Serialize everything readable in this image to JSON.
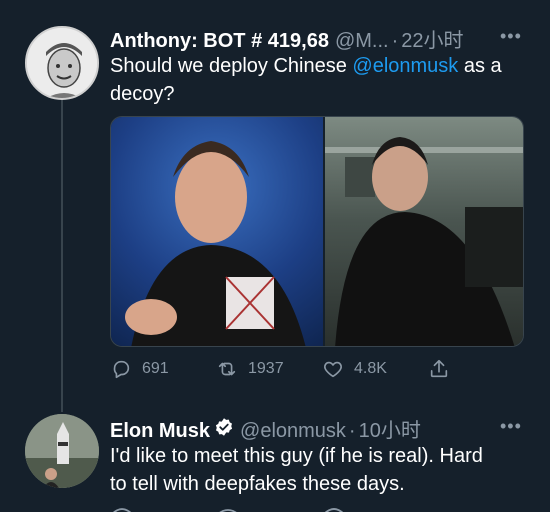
{
  "tweet1": {
    "author_name": "Anthony: BOT # 419,68",
    "handle": "@M...",
    "separator": "·",
    "time": "22小时",
    "more": "•••",
    "text_line1_before": "Should we deploy Chinese ",
    "text_mention": "@elonmusk",
    "text_line1_after": " as a",
    "text_line2": "decoy?",
    "stats": {
      "replies": "691",
      "retweets": "1937",
      "likes": "4.8K"
    }
  },
  "tweet2": {
    "author_name": "Elon Musk",
    "handle": "@elonmusk",
    "separator": "·",
    "time": "10小时",
    "more": "•••",
    "text_line1": "I'd like to meet this guy (if he is real). Hard",
    "text_line2": "to tell with deepfakes these days."
  },
  "icons": [
    "reply-icon",
    "retweet-icon",
    "like-icon",
    "share-icon",
    "verified-badge-icon",
    "more-icon"
  ],
  "colors": {
    "background": "#15202b",
    "text": "#ffffff",
    "secondary": "#8b98a5",
    "accent": "#1d9bf0",
    "divider": "#38444d"
  }
}
